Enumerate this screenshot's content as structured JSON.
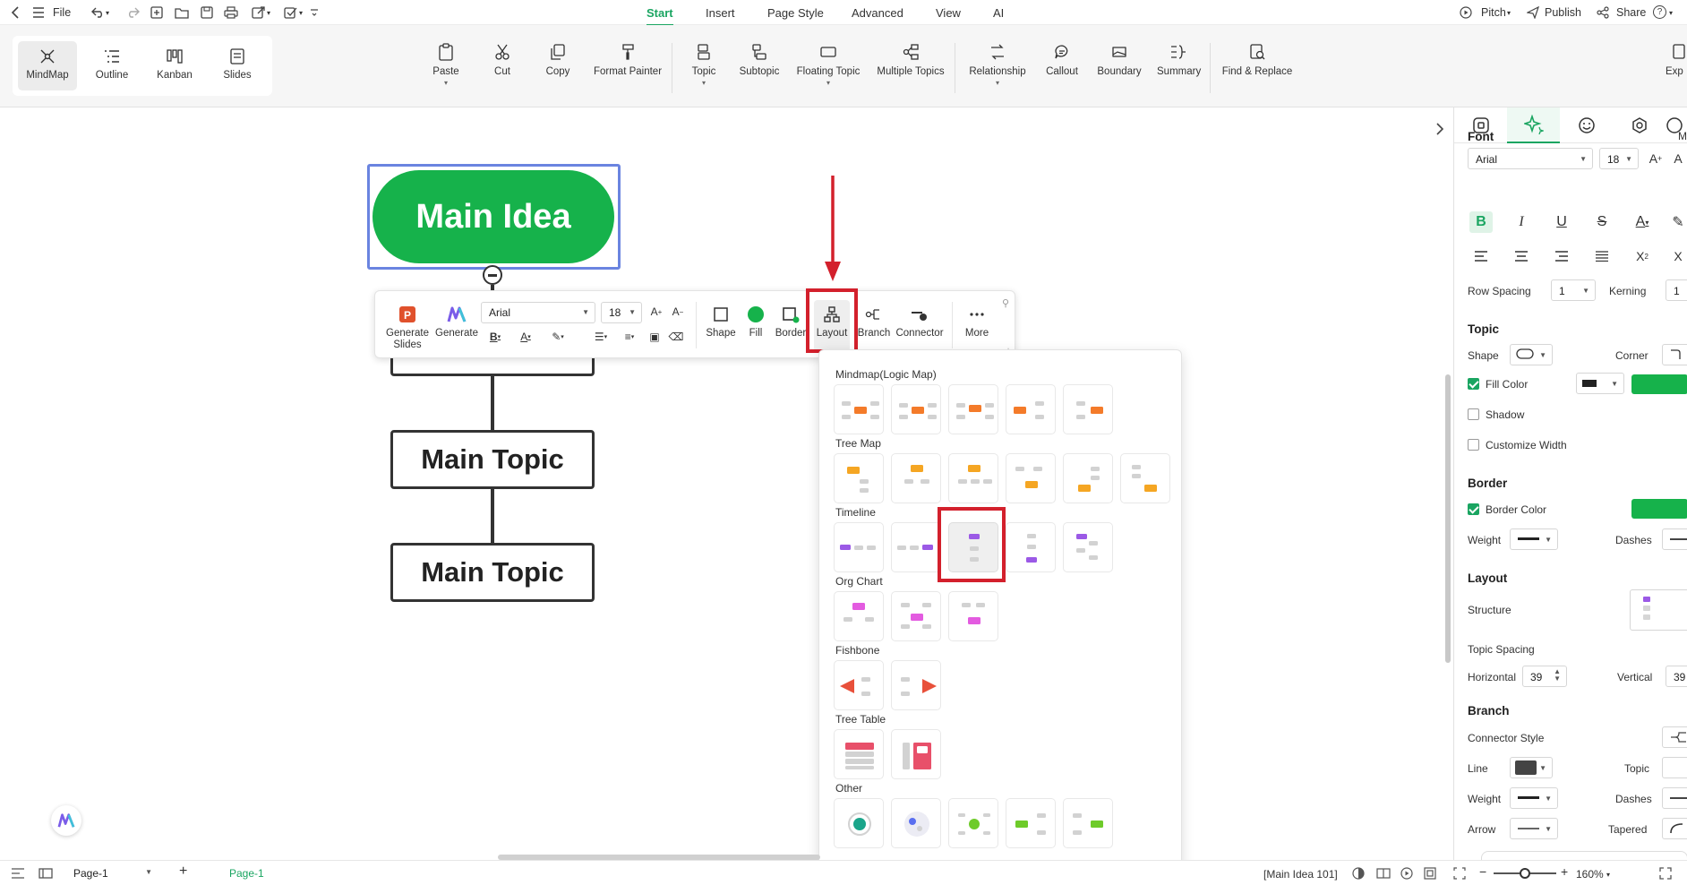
{
  "topbar": {
    "file_label": "File",
    "menus": [
      "Start",
      "Insert",
      "Page Style",
      "Advanced",
      "View",
      "AI"
    ],
    "active_menu": "Start",
    "right": {
      "pitch": "Pitch",
      "publish": "Publish",
      "share": "Share",
      "help": "?"
    }
  },
  "ribbon": {
    "view_modes": [
      "MindMap",
      "Outline",
      "Kanban",
      "Slides"
    ],
    "tools": {
      "paste": "Paste",
      "cut": "Cut",
      "copy": "Copy",
      "format_painter": "Format Painter",
      "topic": "Topic",
      "subtopic": "Subtopic",
      "floating_topic": "Floating Topic",
      "multiple_topics": "Multiple Topics",
      "relationship": "Relationship",
      "callout": "Callout",
      "boundary": "Boundary",
      "summary": "Summary",
      "find_replace": "Find & Replace",
      "export": "Exp"
    }
  },
  "canvas": {
    "main_idea": "Main Idea",
    "topics": [
      "Main Topic",
      "Main Topic"
    ]
  },
  "floating_toolbar": {
    "generate_slides": "Generate Slides",
    "generate": "Generate",
    "font": "Arial",
    "size": "18",
    "shape": "Shape",
    "fill": "Fill",
    "border": "Border",
    "layout": "Layout",
    "branch": "Branch",
    "connector": "Connector",
    "more": "More"
  },
  "layout_panel": {
    "sections": [
      "Mindmap(Logic Map)",
      "Tree Map",
      "Timeline",
      "Org Chart",
      "Fishbone",
      "Tree Table",
      "Other"
    ]
  },
  "right_panel": {
    "font": {
      "title": "Font",
      "family": "Arial",
      "size": "18",
      "extra": "M",
      "row_spacing_label": "Row Spacing",
      "row_spacing": "1",
      "kerning_label": "Kerning",
      "kerning": "1"
    },
    "topic": {
      "title": "Topic",
      "shape_label": "Shape",
      "corner_label": "Corner",
      "fill_color": "Fill Color",
      "shadow": "Shadow",
      "customize_width": "Customize Width"
    },
    "border": {
      "title": "Border",
      "border_color": "Border Color",
      "weight_label": "Weight",
      "dashes_label": "Dashes"
    },
    "layout": {
      "title": "Layout",
      "structure": "Structure",
      "topic_spacing": "Topic Spacing",
      "horizontal_label": "Horizontal",
      "horizontal": "39",
      "vertical_label": "Vertical",
      "vertical": "39"
    },
    "branch": {
      "title": "Branch",
      "connector_style": "Connector Style",
      "line_label": "Line",
      "topic_label": "Topic",
      "weight_label": "Weight",
      "dashes_label": "Dashes",
      "arrow_label": "Arrow",
      "tapered_label": "Tapered"
    },
    "colors": {
      "accent": "#1aa561",
      "fill": "#16b24b",
      "line": "#444444"
    }
  },
  "statusbar": {
    "page_select": "Page-1",
    "page_tab": "Page-1",
    "selection_info": "[Main Idea 101]",
    "zoom": "160%"
  }
}
